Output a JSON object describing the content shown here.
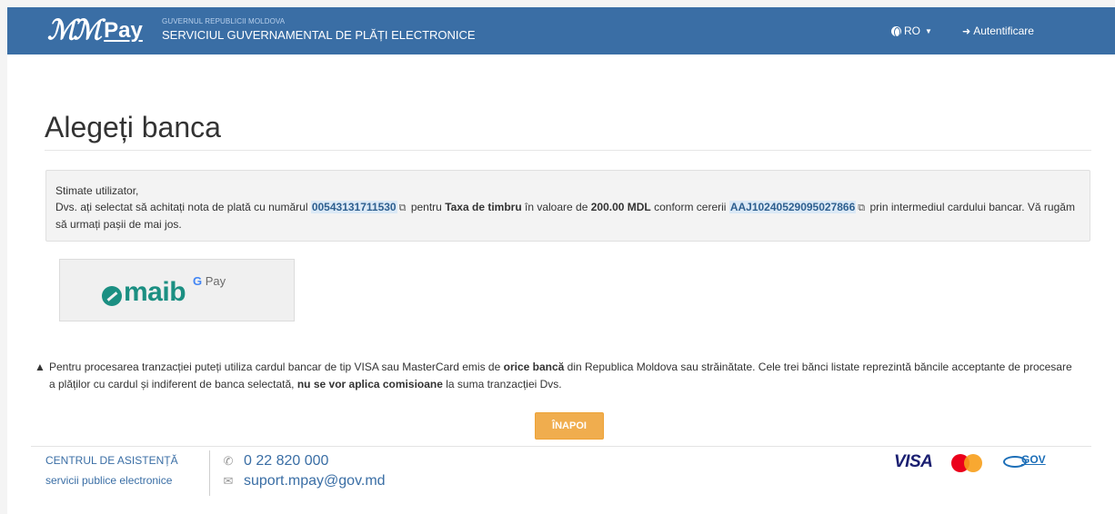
{
  "header": {
    "logo_text": "Pay",
    "gov_small": "GUVERNUL REPUBLICII MOLDOVA",
    "gov_big": "SERVICIUL GUVERNAMENTAL DE PLĂȚI ELECTRONICE",
    "language": "RO",
    "login_label": "Autentificare"
  },
  "main": {
    "title": "Alegeți banca",
    "info": {
      "greeting": "Stimate utilizator,",
      "text_1": "Dvs. ați selectat să achitați nota de plată cu numărul",
      "invoice_number": "00543131711530",
      "text_2": "pentru",
      "service_name": "Taxa de timbru",
      "text_3": "în valoare de",
      "amount": "200.00 MDL",
      "text_4": "conform cererii",
      "request_number": "AAJ10240529095027866",
      "text_5": "prin intermediul cardului bancar. Vă rugăm să urmați pașii de mai jos."
    },
    "bank": {
      "name": "maib",
      "gpay_g": "G",
      "gpay_text": "Pay"
    },
    "notice": {
      "text_1": "Pentru procesarea tranzacției puteți utiliza cardul bancar de tip VISA sau MasterCard emis de",
      "bold_1": "orice bancă",
      "text_2": "din Republica Moldova sau străinătate. Cele trei bănci listate reprezintă băncile acceptante de procesare a plăților cu cardul și indiferent de banca selectată,",
      "bold_2": "nu se vor aplica comisioane",
      "text_3": "la suma tranzacției Dvs."
    },
    "back_label": "ÎNAPOI"
  },
  "footer": {
    "help_title": "CENTRUL DE ASISTENȚĂ",
    "help_subtitle": "servicii publice electronice",
    "phone_prefix": "0 22",
    "phone_number": "820 000",
    "email": "suport.mpay@gov.md",
    "visa_label": "VISA",
    "egov_label": "GOV"
  },
  "icons": {
    "globe": "globe-icon",
    "login": "sign-in-icon",
    "copy": "copy-icon",
    "warning": "warning-triangle-icon",
    "phone": "phone-icon",
    "email": "envelope-icon"
  },
  "colors": {
    "header_bg": "#3a6ea5",
    "link": "#3a6ea5",
    "back_button": "#f0ad4e",
    "maib": "#1b8f82"
  }
}
